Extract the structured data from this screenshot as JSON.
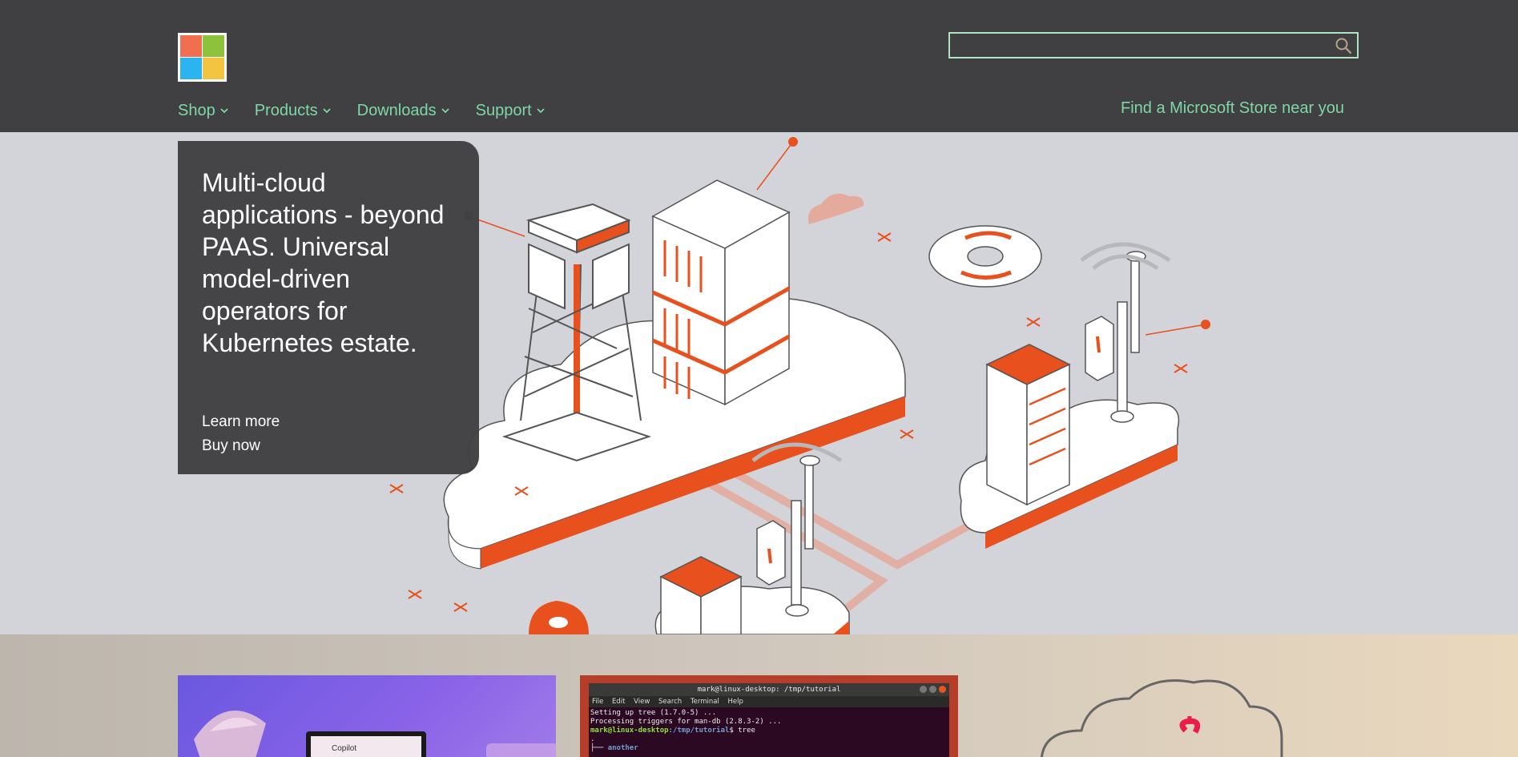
{
  "header": {
    "logo_name": "microsoft-logo",
    "search": {
      "value": "",
      "placeholder": ""
    },
    "nav": [
      {
        "label": "Shop"
      },
      {
        "label": "Products"
      },
      {
        "label": "Downloads"
      },
      {
        "label": "Support"
      }
    ],
    "store_link": "Find a Microsoft Store near you"
  },
  "hero": {
    "title": "Multi-cloud applications - beyond PAAS. Universal model-driven operators for Kubernetes estate.",
    "links": [
      {
        "label": "Learn more"
      },
      {
        "label": "Buy now"
      }
    ]
  },
  "tiles": {
    "copilot_label": "Copilot",
    "terminal": {
      "title": "mark@linux-desktop: /tmp/tutorial",
      "menu": [
        "File",
        "Edit",
        "View",
        "Search",
        "Terminal",
        "Help"
      ],
      "line1": "Setting up tree (1.7.0-5) ...",
      "line2": "Processing triggers for man-db (2.8.3-2) ...",
      "prompt_user": "mark@linux-desktop",
      "prompt_path": ":/tmp/tutorial",
      "prompt_cmd": "$ tree",
      "line4": ".",
      "line5_prefix": "├── ",
      "line5_dir": "another"
    }
  },
  "colors": {
    "header_bg": "#404043",
    "accent_green": "#7ed7a4",
    "hero_bg": "#d3d4da",
    "illustration_orange": "#e8501e"
  }
}
